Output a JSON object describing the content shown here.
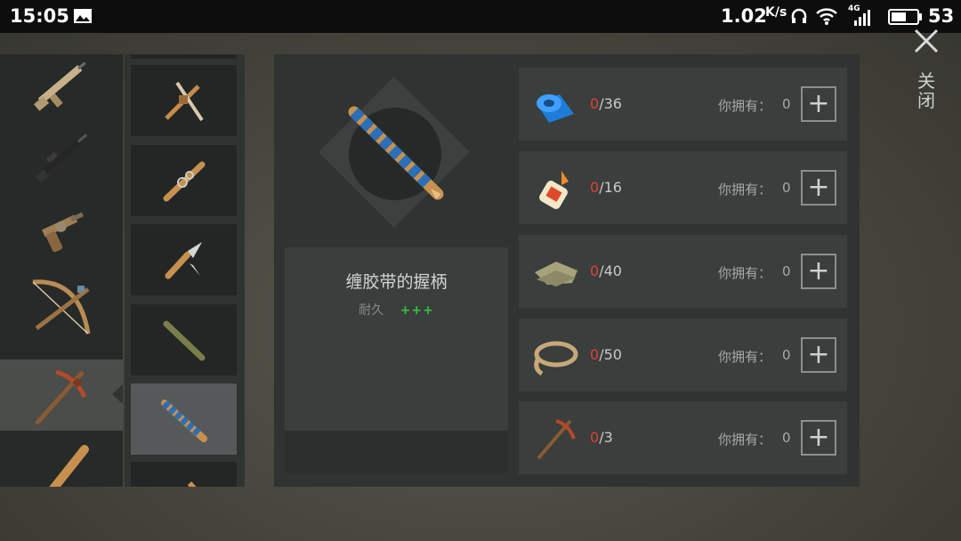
{
  "status_bar": {
    "time": "15:05",
    "net_speed": "1.02",
    "net_unit": "K/s",
    "signal_label": "4G",
    "battery": "53"
  },
  "weapons": [
    "scar-rifle-icon",
    "m16-rifle-icon",
    "revolver-icon",
    "crossbow-icon",
    "pickaxe-icon",
    "bat-icon"
  ],
  "selected_weapon_index": 4,
  "recipes": [
    "dual-blade-icon",
    "nailed-handle-icon",
    "knife-handle-icon",
    "wooden-handle-icon",
    "taped-handle-icon"
  ],
  "selected_recipe_index": 4,
  "detail": {
    "item_name": "缠胶带的握柄",
    "durability_label": "耐久",
    "durability_value": "+++"
  },
  "ingredients": [
    {
      "icon": "duct-tape-icon",
      "have": "0",
      "need": "/36",
      "own_label": "你拥有：",
      "own_value": "0"
    },
    {
      "icon": "glue-icon",
      "have": "0",
      "need": "/16",
      "own_label": "你拥有：",
      "own_value": "0"
    },
    {
      "icon": "cloth-icon",
      "have": "0",
      "need": "/40",
      "own_label": "你拥有：",
      "own_value": "0"
    },
    {
      "icon": "rope-icon",
      "have": "0",
      "need": "/50",
      "own_label": "你拥有：",
      "own_value": "0"
    },
    {
      "icon": "pickaxe-icon",
      "have": "0",
      "need": "/3",
      "own_label": "你拥有：",
      "own_value": "0"
    }
  ],
  "plus_symbol": "+",
  "close_label": "关闭",
  "colors": {
    "count_have": "#e0403a",
    "durability": "#36c43a",
    "panel": "#2f3331",
    "row": "#3a3e3c"
  }
}
